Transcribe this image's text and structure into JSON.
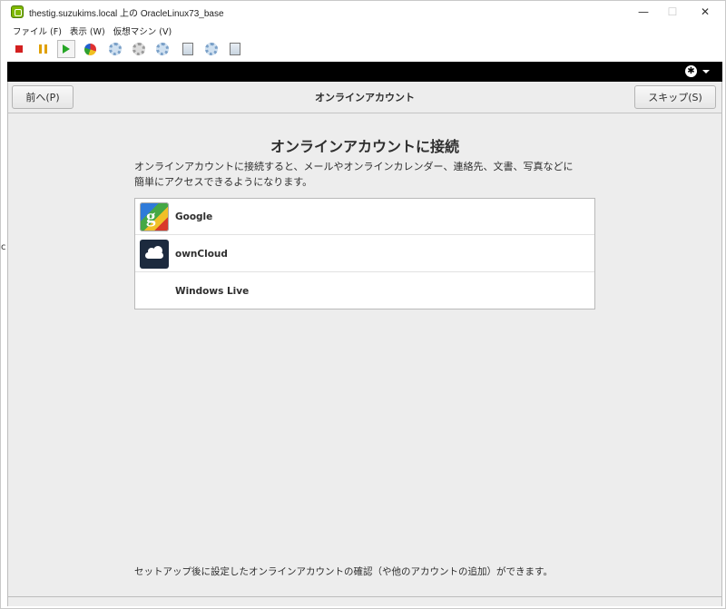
{
  "window": {
    "title": "thestig.suzukims.local 上の OracleLinux73_base",
    "controls": {
      "minimize": "—",
      "maximize": "☐",
      "close": "✕"
    }
  },
  "menubar": {
    "items": [
      {
        "label": "ファイル (F)"
      },
      {
        "label": "表示 (W)"
      },
      {
        "label": "仮想マシン (V)"
      }
    ]
  },
  "toolbar": {
    "icons": [
      "stop-icon",
      "pause-icon",
      "play-icon",
      "reset-icon",
      "snapshot-icon",
      "snapshot-restore-icon",
      "snapshot-manager-icon",
      "send-keys-icon",
      "settings-icon",
      "usb-icon"
    ]
  },
  "topbar": {
    "accessibility_icon": "♿",
    "accessibility_glyph": "✱"
  },
  "header": {
    "back_label": "前へ(P)",
    "title": "オンラインアカウント",
    "skip_label": "スキップ(S)"
  },
  "main": {
    "heading": "オンラインアカウントに接続",
    "description_line1": "オンラインアカウントに接続すると、メールやオンラインカレンダー、連絡先、文書、写真などに",
    "description_line2": "簡単にアクセスできるようになります。",
    "accounts": [
      {
        "label": "Google",
        "icon": "google-icon"
      },
      {
        "label": "ownCloud",
        "icon": "owncloud-icon"
      },
      {
        "label": "Windows Live",
        "icon": ""
      }
    ],
    "footer": "セットアップ後に設定したオンラインアカウントの確認（や他のアカウントの追加）ができます。"
  },
  "edge_text": "c"
}
